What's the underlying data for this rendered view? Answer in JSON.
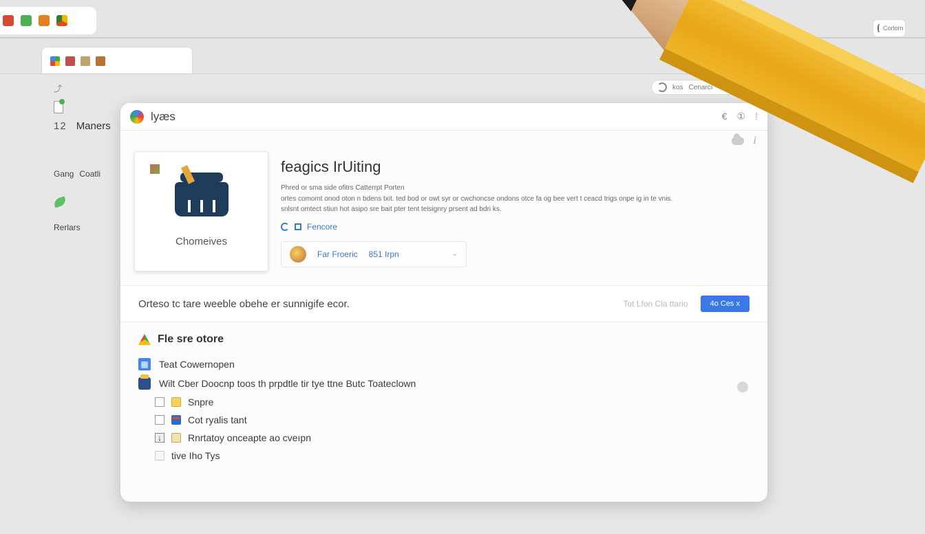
{
  "outer_tab": {
    "icons": [
      "app-red",
      "app-green",
      "app-orange",
      "app-chrome"
    ]
  },
  "inner_tab": {
    "icons": [
      "chrome",
      "red",
      "tan",
      "amber"
    ]
  },
  "sidebar": {
    "num": "12",
    "label_top": "Maners",
    "label_gang": "Gang",
    "label_coat": "Coatli",
    "label_recs": "Rerlars"
  },
  "search_pill": {
    "a": "kos",
    "b": "Cenarcı"
  },
  "corner_box": {
    "label": "Corlorn"
  },
  "app_header": {
    "title": "lyæs",
    "right_a": "€",
    "right_b": "①",
    "right_c": "⁞"
  },
  "hero": {
    "card_caption": "Chomeives",
    "title": "feagics IrUiting",
    "desc_l1": "Phred or sma side ofitrs Catterrpt Porten",
    "desc_l2": "ortes comomt onod oton n bdens txit. ted bod or owt syr or cwchoncse ondons otce fa og bee vert t ceacd trigs onpe ig in te vnis.",
    "desc_l3": "snlsnt omtect stiun hot asipo sre bait pter tent teisignry prsent ad bdri ks.",
    "feature_link": "Fencore",
    "profile_name": "Far Froeric",
    "profile_meta": "851 Irpn"
  },
  "prompt": {
    "msg": "Orteso tc tare weeble obehe er sunnigife ecor.",
    "ghost": "Tot Lfon Cla ttario",
    "cta": "4o Ces x"
  },
  "list": {
    "heading": "Fle sre otore",
    "items": [
      "Teat Cowernopen",
      "Wilt Cber Doocnp toos th prpdtle tir tye ttne Butc Toateclown",
      "Snpre",
      "Cot ryalis tant",
      "Rnrtatoy onceapte ao cveıpn",
      "tive Iho Tys"
    ]
  }
}
